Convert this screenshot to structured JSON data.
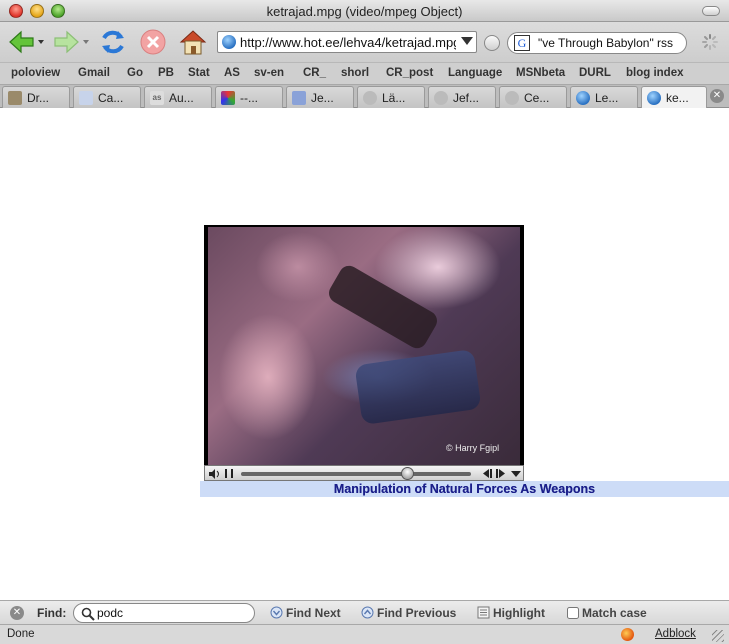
{
  "window": {
    "title": "ketrajad.mpg (video/mpeg Object)"
  },
  "toolbar": {
    "url": "http://www.hot.ee/lehva4/ketrajad.mpg",
    "search_query": "\"ve Through Babylon\" rss",
    "search_engine_icon": "G"
  },
  "bookmarks": [
    "poloview",
    "Gmail",
    "Go",
    "PB",
    "Stat",
    "AS",
    "sv-en",
    "CR_",
    "shorl",
    "CR_post",
    "Language",
    "MSNbeta",
    "DURL",
    "blog index"
  ],
  "tabs": [
    {
      "label": "Dr...",
      "icon": "puzzle-icon"
    },
    {
      "label": "Ca...",
      "icon": "cal-icon"
    },
    {
      "label": "Au...",
      "icon": "as-icon"
    },
    {
      "label": "--...",
      "icon": "triangle-icon"
    },
    {
      "label": "Je...",
      "icon": "chart-icon"
    },
    {
      "label": "Lä...",
      "icon": "gray-globe-icon"
    },
    {
      "label": "Jef...",
      "icon": "gray-globe-icon"
    },
    {
      "label": "Ce...",
      "icon": "gray-globe-icon"
    },
    {
      "label": "Le...",
      "icon": "globe-icon"
    },
    {
      "label": "ke...",
      "icon": "globe-icon",
      "active": true
    }
  ],
  "video": {
    "watermark": "© Harry Fgipl",
    "caption": "Manipulation of Natural Forces As Weapons",
    "progress": 0.72
  },
  "findbar": {
    "label": "Find:",
    "query": "podc",
    "find_next": "Find Next",
    "find_previous": "Find Previous",
    "highlight": "Highlight",
    "match_case": "Match case"
  },
  "status": {
    "text": "Done",
    "adblock": "Adblock"
  }
}
